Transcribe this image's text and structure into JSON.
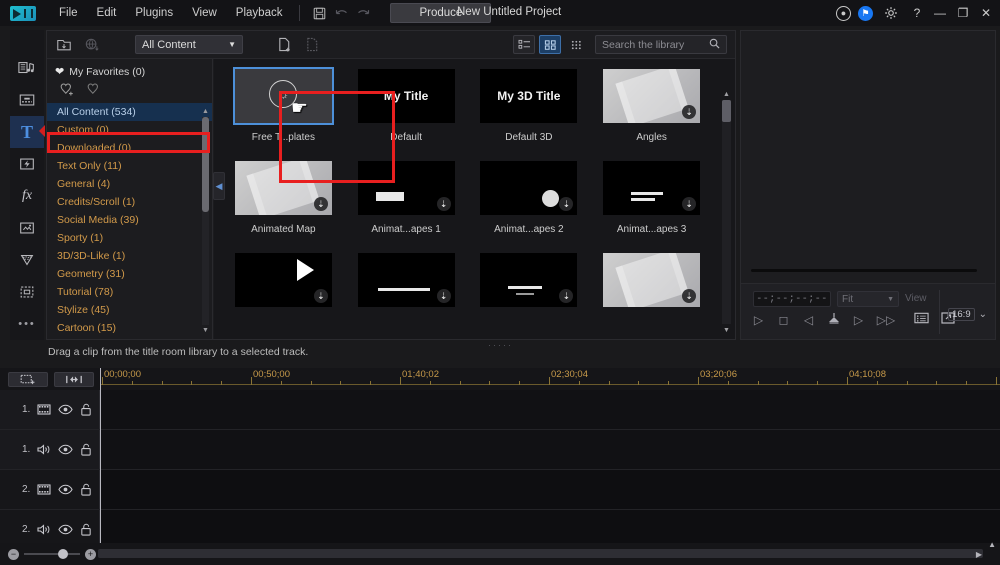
{
  "titlebar": {
    "logo": "cyberlink-logo",
    "menus": [
      "File",
      "Edit",
      "Plugins",
      "View",
      "Playback"
    ],
    "save_icon": "save-icon",
    "undo_icon": "undo-icon",
    "redo_icon": "redo-icon",
    "produce_label": "Produce",
    "project_title": "New Untitled Project",
    "account_icon": "account-icon",
    "notification_icon": "notification-bell-icon",
    "settings_icon": "gear-icon",
    "help_icon": "?",
    "minimize": "—",
    "maximize": "❐",
    "close": "✕"
  },
  "rail": {
    "items": [
      {
        "name": "media-room",
        "icon": "media-music-icon"
      },
      {
        "name": "effect-room",
        "icon": "effect-clip-icon"
      },
      {
        "name": "title-room",
        "icon": "T",
        "active": true
      },
      {
        "name": "transition-room",
        "icon": "transition-icon"
      },
      {
        "name": "fx-room",
        "icon": "fx"
      },
      {
        "name": "overlay-room",
        "icon": "overlay-icon"
      },
      {
        "name": "particle-room",
        "icon": "particle-icon"
      },
      {
        "name": "subtitle-room",
        "icon": "subtitle-icon"
      },
      {
        "name": "more-rooms",
        "icon": "•••"
      }
    ]
  },
  "library": {
    "toolbar": {
      "import_icon": "import-media-icon",
      "download_icon": "download-globe-icon",
      "filter_value": "All Content",
      "new_icon": "new-title-icon",
      "export_icon": "export-title-icon",
      "view_list_icon": "list-view-icon",
      "view_grid_icon": "grid-view-icon",
      "view_dots_icon": "thumbnail-size-icon",
      "search_placeholder": "Search the library",
      "search_icon": "search-icon"
    },
    "favorites": {
      "label": "My Favorites (0)",
      "heart_icon": "heart-icon",
      "add_fav_icon": "add-favorite-icon",
      "fav_icon": "favorite-tag-icon"
    },
    "categories": [
      {
        "label": "All Content (534)",
        "selected": true
      },
      {
        "label": "Custom  (0)"
      },
      {
        "label": "Downloaded  (0)"
      },
      {
        "label": "Text Only  (11)"
      },
      {
        "label": "General  (4)"
      },
      {
        "label": "Credits/Scroll  (1)"
      },
      {
        "label": "Social Media  (39)"
      },
      {
        "label": "Sporty  (1)"
      },
      {
        "label": "3D/3D-Like  (1)"
      },
      {
        "label": "Geometry  (31)"
      },
      {
        "label": "Tutorial  (78)"
      },
      {
        "label": "Stylize  (45)"
      },
      {
        "label": "Cartoon  (15)"
      }
    ],
    "items": [
      {
        "label": "Free T...plates",
        "kind": "bulb",
        "selected": true,
        "download": false
      },
      {
        "label": "Default",
        "kind": "text",
        "text": "My Title",
        "download": false
      },
      {
        "label": "Default 3D",
        "kind": "text",
        "text": "My 3D Title",
        "download": false
      },
      {
        "label": "Angles",
        "kind": "film",
        "download": true
      },
      {
        "label": "Animated Map",
        "kind": "film",
        "download": true
      },
      {
        "label": "Animat...apes 1",
        "kind": "lowerthird",
        "download": true
      },
      {
        "label": "Animat...apes 2",
        "kind": "globe",
        "download": true
      },
      {
        "label": "Animat...apes 3",
        "kind": "bars",
        "download": true
      },
      {
        "label": "",
        "kind": "play",
        "download": true
      },
      {
        "label": "",
        "kind": "barsingle",
        "download": true
      },
      {
        "label": "",
        "kind": "barsmall",
        "download": true
      },
      {
        "label": "",
        "kind": "film",
        "download": true
      }
    ]
  },
  "preview": {
    "timecode": "--;--;--;--",
    "fit_value": "Fit",
    "view_label": "View",
    "buttons": [
      {
        "name": "play-button",
        "glyph": "▷"
      },
      {
        "name": "stop-button",
        "glyph": "◻"
      },
      {
        "name": "previous-frame-button",
        "glyph": "◁"
      },
      {
        "name": "capture-snapshot-button",
        "glyph": "⛰"
      },
      {
        "name": "next-frame-button",
        "glyph": "▷"
      },
      {
        "name": "fast-forward-button",
        "glyph": "▷▷"
      },
      {
        "name": "preview-menu-button",
        "glyph": "▤"
      },
      {
        "name": "popout-preview-button",
        "glyph": "↗"
      }
    ],
    "aspect_ratio": "16:9",
    "aspect_caret": "⌄"
  },
  "hint": "Drag a clip from the title room library to a selected track.",
  "timeline": {
    "toolbar": [
      {
        "name": "timeline-track-manager-button",
        "icon": "track-manager-icon"
      },
      {
        "name": "timeline-marker-button",
        "icon": "timeline-marker-icon"
      }
    ],
    "ruler_labels": [
      "00;00;00",
      "00;50;00",
      "01;40;02",
      "02;30;04",
      "03;20;06",
      "04;10;08"
    ],
    "tracks": [
      {
        "number": "1.",
        "type": "video",
        "eye": "eye-icon",
        "lock": "unlock-icon"
      },
      {
        "number": "1.",
        "type": "audio",
        "eye": "eye-icon",
        "lock": "unlock-icon"
      },
      {
        "number": "2.",
        "type": "video",
        "eye": "eye-icon",
        "lock": "unlock-icon"
      },
      {
        "number": "2.",
        "type": "audio",
        "eye": "eye-icon",
        "lock": "unlock-icon"
      }
    ],
    "zoom_out": "−",
    "zoom_in": "+",
    "scroll_left": "◀",
    "scroll_right": "▶"
  }
}
